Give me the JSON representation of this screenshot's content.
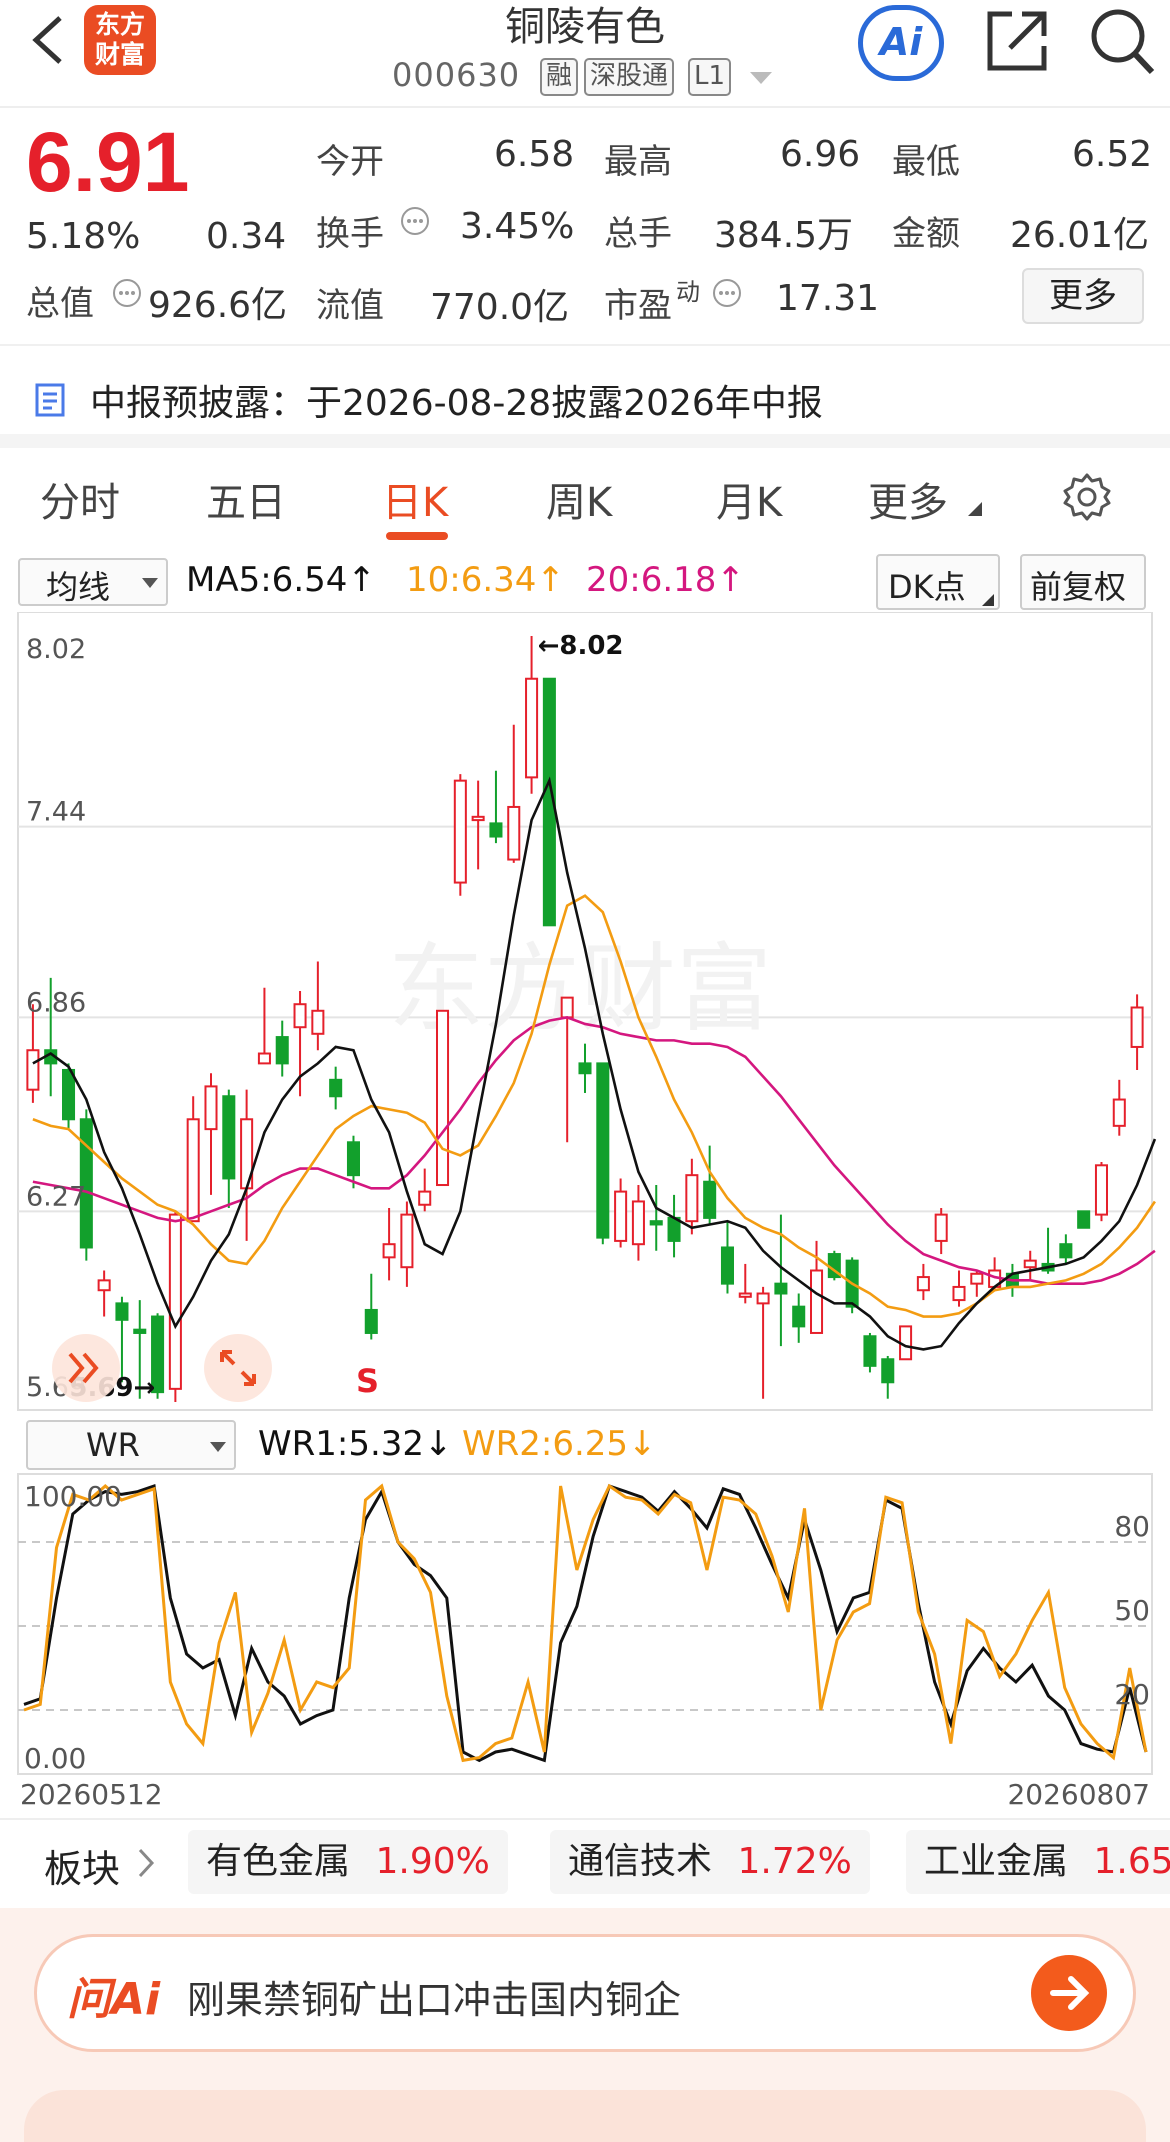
{
  "header": {
    "logo": "东方财富",
    "title": "铜陵有色",
    "code": "000630",
    "tags": [
      "融",
      "深股通",
      "L1"
    ],
    "ai_label": "Ai"
  },
  "quote": {
    "price": "6.91",
    "change_pct": "5.18%",
    "change": "0.34",
    "open_label": "今开",
    "open": "6.58",
    "high_label": "最高",
    "high": "6.96",
    "low_label": "最低",
    "low": "6.52",
    "turnover_label": "换手",
    "turnover": "3.45%",
    "volume_label": "总手",
    "volume": "384.5万",
    "amount_label": "金额",
    "amount": "26.01亿",
    "mktcap_label": "总值",
    "mktcap": "926.6亿",
    "float_label": "流值",
    "float": "770.0亿",
    "pe_label": "市盈",
    "pe_sup": "动",
    "pe": "17.31",
    "more": "更多"
  },
  "notice": {
    "text": "中报预披露：于2026-08-28披露2026年中报"
  },
  "tabs": [
    "分时",
    "五日",
    "日K",
    "周K",
    "月K",
    "更多"
  ],
  "active_tab": "日K",
  "indicator_bar": {
    "selector": "均线",
    "ma5": "MA5:6.54↑",
    "ma10": "10:6.34↑",
    "ma20": "20:6.18↑",
    "dk": "DK点",
    "adjust": "前复权"
  },
  "colors": {
    "up": "#e5202b",
    "down": "#12a02c",
    "ma5": "#111111",
    "ma10": "#f39c12",
    "ma20": "#d4177f",
    "accent": "#ea4c23",
    "wr1": "#111111",
    "wr2": "#f39c12"
  },
  "kline": {
    "y_labels": [
      "8.02",
      "7.44",
      "6.86",
      "6.27",
      "5.69"
    ],
    "ylim": [
      5.69,
      8.02
    ],
    "max_label": "←8.02",
    "min_label": "5.69→",
    "signal": "S",
    "watermark": "东方财富",
    "candles": [
      [
        6.64,
        6.76,
        6.9,
        6.6
      ],
      [
        6.76,
        6.72,
        6.98,
        6.62
      ],
      [
        6.7,
        6.55,
        6.72,
        6.52
      ],
      [
        6.55,
        6.16,
        6.58,
        6.12
      ],
      [
        6.03,
        6.06,
        6.09,
        5.95
      ],
      [
        5.99,
        5.94,
        6.01,
        5.75
      ],
      [
        5.91,
        5.9,
        6.0,
        5.7
      ],
      [
        5.95,
        5.72,
        5.96,
        5.7
      ],
      [
        5.73,
        6.26,
        6.27,
        5.69
      ],
      [
        6.24,
        6.55,
        6.62,
        6.24
      ],
      [
        6.52,
        6.65,
        6.69,
        6.32
      ],
      [
        6.62,
        6.37,
        6.64,
        6.28
      ],
      [
        6.34,
        6.55,
        6.64,
        6.18
      ],
      [
        6.72,
        6.75,
        6.95,
        6.72
      ],
      [
        6.8,
        6.72,
        6.85,
        6.68
      ],
      [
        6.83,
        6.9,
        6.94,
        6.62
      ],
      [
        6.81,
        6.88,
        7.03,
        6.76
      ],
      [
        6.67,
        6.62,
        6.71,
        6.58
      ],
      [
        6.48,
        6.38,
        6.5,
        6.34
      ],
      [
        5.97,
        5.9,
        6.08,
        5.88
      ],
      [
        6.13,
        6.17,
        6.28,
        6.06
      ],
      [
        6.1,
        6.26,
        6.3,
        6.04
      ],
      [
        6.29,
        6.33,
        6.4,
        6.27
      ],
      [
        6.35,
        6.88,
        6.88,
        6.35
      ],
      [
        7.27,
        7.58,
        7.6,
        7.23
      ],
      [
        7.46,
        7.47,
        7.58,
        7.31
      ],
      [
        7.45,
        7.41,
        7.61,
        7.39
      ],
      [
        7.34,
        7.5,
        7.75,
        7.33
      ],
      [
        7.59,
        7.89,
        8.02,
        7.54
      ],
      [
        7.89,
        7.14,
        7.89,
        7.14
      ],
      [
        6.86,
        6.92,
        6.92,
        6.48
      ],
      [
        6.72,
        6.69,
        6.78,
        6.63
      ],
      [
        6.72,
        6.19,
        6.72,
        6.17
      ],
      [
        6.18,
        6.33,
        6.37,
        6.16
      ],
      [
        6.17,
        6.3,
        6.35,
        6.12
      ],
      [
        6.24,
        6.23,
        6.35,
        6.15
      ],
      [
        6.25,
        6.18,
        6.32,
        6.13
      ],
      [
        6.24,
        6.38,
        6.43,
        6.2
      ],
      [
        6.36,
        6.25,
        6.47,
        6.23
      ],
      [
        6.16,
        6.05,
        6.24,
        6.02
      ],
      [
        6.01,
        6.02,
        6.11,
        5.99
      ],
      [
        5.99,
        6.02,
        6.04,
        5.7
      ],
      [
        6.05,
        6.02,
        6.26,
        5.86
      ],
      [
        5.98,
        5.92,
        6.02,
        5.87
      ],
      [
        5.9,
        6.09,
        6.18,
        5.9
      ],
      [
        6.14,
        6.07,
        6.15,
        6.06
      ],
      [
        6.12,
        5.98,
        6.13,
        5.96
      ],
      [
        5.89,
        5.8,
        5.9,
        5.78
      ],
      [
        5.82,
        5.75,
        5.83,
        5.7
      ],
      [
        5.82,
        5.92,
        5.92,
        5.82
      ],
      [
        6.03,
        6.07,
        6.11,
        6.0
      ],
      [
        6.18,
        6.26,
        6.28,
        6.14
      ],
      [
        6.0,
        6.04,
        6.09,
        5.98
      ],
      [
        6.05,
        6.08,
        6.09,
        6.01
      ],
      [
        6.04,
        6.09,
        6.13,
        6.03
      ],
      [
        6.08,
        6.04,
        6.11,
        6.01
      ],
      [
        6.1,
        6.12,
        6.15,
        6.06
      ],
      [
        6.11,
        6.09,
        6.22,
        6.08
      ],
      [
        6.17,
        6.13,
        6.2,
        6.11
      ],
      [
        6.27,
        6.22,
        6.25,
        6.22
      ],
      [
        6.26,
        6.41,
        6.42,
        6.24
      ],
      [
        6.53,
        6.61,
        6.67,
        6.5
      ],
      [
        6.77,
        6.89,
        6.93,
        6.7
      ]
    ],
    "ma5": [
      6.72,
      6.75,
      6.71,
      6.61,
      6.45,
      6.34,
      6.2,
      6.05,
      5.92,
      6.01,
      6.12,
      6.2,
      6.34,
      6.51,
      6.61,
      6.68,
      6.72,
      6.77,
      6.76,
      6.61,
      6.51,
      6.33,
      6.17,
      6.14,
      6.27,
      6.56,
      6.84,
      7.17,
      7.46,
      7.58,
      7.3,
      7.07,
      6.81,
      6.58,
      6.39,
      6.28,
      6.25,
      6.22,
      6.23,
      6.24,
      6.22,
      6.15,
      6.1,
      6.06,
      6.02,
      5.99,
      5.99,
      5.95,
      5.89,
      5.86,
      5.85,
      5.86,
      5.93,
      5.99,
      6.04,
      6.08,
      6.09,
      6.1,
      6.11,
      6.13,
      6.18,
      6.24,
      6.35,
      6.49
    ],
    "ma10": [
      6.55,
      6.53,
      6.52,
      6.47,
      6.42,
      6.37,
      6.33,
      6.29,
      6.27,
      6.23,
      6.17,
      6.12,
      6.11,
      6.18,
      6.28,
      6.36,
      6.44,
      6.52,
      6.56,
      6.59,
      6.58,
      6.57,
      6.54,
      6.46,
      6.44,
      6.47,
      6.56,
      6.66,
      6.81,
      7.02,
      7.2,
      7.23,
      7.18,
      7.03,
      6.86,
      6.74,
      6.61,
      6.51,
      6.39,
      6.31,
      6.25,
      6.22,
      6.2,
      6.16,
      6.13,
      6.09,
      6.05,
      6.02,
      5.98,
      5.97,
      5.95,
      5.95,
      5.96,
      5.99,
      6.03,
      6.04,
      6.04,
      6.05,
      6.06,
      6.08,
      6.11,
      6.16,
      6.22,
      6.3
    ],
    "ma20": [
      6.36,
      6.35,
      6.34,
      6.33,
      6.31,
      6.29,
      6.27,
      6.25,
      6.24,
      6.25,
      6.27,
      6.29,
      6.31,
      6.35,
      6.38,
      6.4,
      6.4,
      6.38,
      6.36,
      6.34,
      6.34,
      6.38,
      6.44,
      6.51,
      6.58,
      6.66,
      6.73,
      6.79,
      6.83,
      6.85,
      6.86,
      6.84,
      6.83,
      6.81,
      6.8,
      6.79,
      6.79,
      6.78,
      6.78,
      6.77,
      6.74,
      6.68,
      6.62,
      6.55,
      6.48,
      6.41,
      6.35,
      6.29,
      6.23,
      6.18,
      6.14,
      6.12,
      6.1,
      6.09,
      6.07,
      6.06,
      6.06,
      6.05,
      6.05,
      6.05,
      6.06,
      6.08,
      6.11,
      6.15
    ]
  },
  "wr": {
    "selector": "WR",
    "wr1_label": "WR1:5.32↓",
    "wr2_label": "WR2:6.25↓",
    "left_labels": [
      "100.00",
      "0.00"
    ],
    "right_labels": [
      "80",
      "50",
      "20"
    ],
    "ylim": [
      0,
      100
    ],
    "date_start": "20260512",
    "date_end": "20260807",
    "wr1": [
      22,
      24,
      60,
      90,
      95,
      98,
      97,
      98,
      100,
      60,
      40,
      35,
      38,
      18,
      42,
      30,
      25,
      15,
      18,
      20,
      60,
      88,
      98,
      80,
      72,
      68,
      60,
      5,
      2,
      5,
      6,
      4,
      2,
      44,
      57,
      82,
      100,
      98,
      96,
      91,
      98,
      92,
      85,
      99,
      97,
      85,
      72,
      60,
      88,
      70,
      48,
      60,
      62,
      95,
      92,
      58,
      30,
      15,
      34,
      42,
      35,
      30,
      36,
      25,
      20,
      8,
      6,
      5,
      28,
      5
    ],
    "wr2": [
      20,
      22,
      78,
      97,
      95,
      100,
      95,
      97,
      99,
      30,
      15,
      8,
      44,
      62,
      12,
      26,
      45,
      20,
      30,
      28,
      35,
      95,
      100,
      80,
      74,
      62,
      25,
      2,
      3,
      8,
      10,
      30,
      5,
      100,
      70,
      88,
      100,
      96,
      95,
      90,
      97,
      94,
      70,
      96,
      95,
      90,
      75,
      55,
      92,
      20,
      45,
      55,
      58,
      96,
      94,
      55,
      40,
      8,
      52,
      48,
      32,
      40,
      52,
      62,
      28,
      15,
      8,
      3,
      35,
      5
    ]
  },
  "sector": {
    "label": "板块",
    "items": [
      {
        "name": "有色金属",
        "pct": "1.90%"
      },
      {
        "name": "通信技术",
        "pct": "1.72%"
      },
      {
        "name": "工业金属",
        "pct": "1.65"
      }
    ]
  },
  "ai_bar": {
    "logo": "问Ai",
    "prompt": "刚果禁铜矿出口冲击国内铜企"
  }
}
